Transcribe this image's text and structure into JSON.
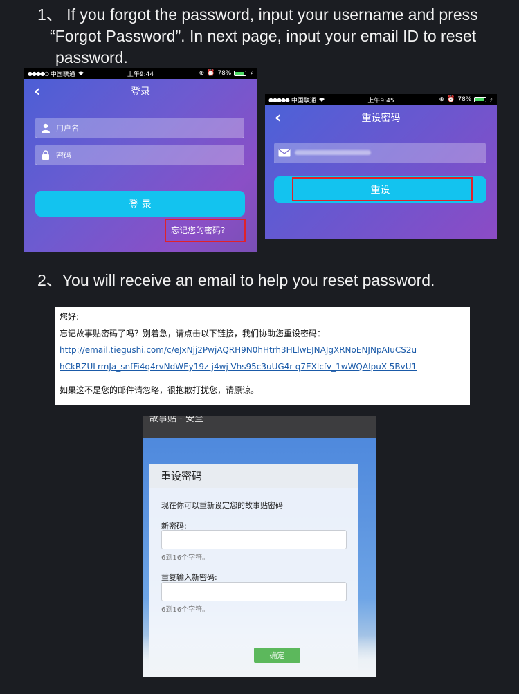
{
  "steps": {
    "step1": {
      "line1": "1、 If you forgot the password, input your username and press",
      "line2": "“Forgot Password”. In next page, input your email ID to reset",
      "line3": "password."
    },
    "step2": "2、You will receive an email to help you reset password."
  },
  "login_screen": {
    "status": {
      "carrier": "中国联通",
      "signal_dots": "●●●●○",
      "time": "上午9:44",
      "battery": "78%"
    },
    "title": "登录",
    "username_placeholder": "用户名",
    "password_placeholder": "密码",
    "login_button": "登 录",
    "forgot_link": "忘记您的密码?"
  },
  "reset_screen": {
    "status": {
      "carrier": "中国联通",
      "signal_dots": "●●●●●",
      "time": "上午9:45",
      "battery": "78%"
    },
    "title": "重设密码",
    "reset_button": "重设"
  },
  "email": {
    "greeting": "您好:",
    "body": "忘记故事贴密码了吗？别着急，请点击以下链接，我们协助您重设密码：",
    "link_line1": "http://email.tiegushi.com/c/eJxNjj2PwjAQRH9N0hHtrh3HLlwEJNAJgXRNoENJNpAIuCS2u",
    "link_line2": "hCkRZULrmJa_snfFi4q4rvNdWEy19z-j4wj-Vhs95c3uUG4r-q7EXlcfv_1wWQAIpuX-5BvU1",
    "footer": "如果这不是您的邮件请忽略，很抱歉打扰您，请原谅。"
  },
  "web_page": {
    "topbar": "故事贴 - 安全",
    "heading": "重设密码",
    "description": "现在你可以重新设定您的故事贴密码",
    "new_password_label": "新密码:",
    "new_password_hint": "6到16个字符。",
    "repeat_password_label": "重复输入新密码:",
    "repeat_password_hint": "6到16个字符。",
    "confirm_button": "确定"
  },
  "colors": {
    "accent_cyan": "#13c3ef",
    "highlight_red": "#e0222a",
    "confirm_green": "#5cb85c",
    "link_blue": "#1a5aa8"
  }
}
